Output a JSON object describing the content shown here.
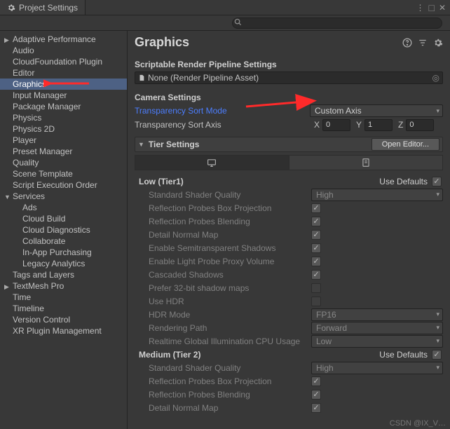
{
  "window": {
    "title": "Project Settings"
  },
  "search": {
    "placeholder": ""
  },
  "sidebar": [
    {
      "label": "Adaptive Performance",
      "has_children": true,
      "selected": false
    },
    {
      "label": "Audio"
    },
    {
      "label": "CloudFoundation Plugin"
    },
    {
      "label": "Editor"
    },
    {
      "label": "Graphics",
      "selected": true
    },
    {
      "label": "Input Manager"
    },
    {
      "label": "Package Manager"
    },
    {
      "label": "Physics"
    },
    {
      "label": "Physics 2D"
    },
    {
      "label": "Player"
    },
    {
      "label": "Preset Manager"
    },
    {
      "label": "Quality"
    },
    {
      "label": "Scene Template"
    },
    {
      "label": "Script Execution Order"
    },
    {
      "label": "Services",
      "expanded": true,
      "children": [
        {
          "label": "Ads"
        },
        {
          "label": "Cloud Build"
        },
        {
          "label": "Cloud Diagnostics"
        },
        {
          "label": "Collaborate"
        },
        {
          "label": "In-App Purchasing"
        },
        {
          "label": "Legacy Analytics"
        }
      ]
    },
    {
      "label": "Tags and Layers"
    },
    {
      "label": "TextMesh Pro",
      "has_children": true
    },
    {
      "label": "Time"
    },
    {
      "label": "Timeline"
    },
    {
      "label": "Version Control"
    },
    {
      "label": "XR Plugin Management"
    }
  ],
  "page": {
    "title": "Graphics",
    "srp": {
      "title": "Scriptable Render Pipeline Settings",
      "value": "None (Render Pipeline Asset)"
    },
    "camera": {
      "title": "Camera Settings",
      "sort_mode_label": "Transparency Sort Mode",
      "sort_mode_value": "Custom Axis",
      "sort_axis_label": "Transparency Sort Axis",
      "x_label": "X",
      "x": "0",
      "y_label": "Y",
      "y": "1",
      "z_label": "Z",
      "z": "0"
    },
    "tier": {
      "header": "Tier Settings",
      "open_editor": "Open Editor...",
      "use_defaults_label": "Use Defaults",
      "groups": [
        {
          "head": "Low (Tier1)",
          "use_defaults": true,
          "rows": [
            {
              "label": "Standard Shader Quality",
              "type": "dropdown",
              "value": "High"
            },
            {
              "label": "Reflection Probes Box Projection",
              "type": "check",
              "value": true
            },
            {
              "label": "Reflection Probes Blending",
              "type": "check",
              "value": true
            },
            {
              "label": "Detail Normal Map",
              "type": "check",
              "value": true
            },
            {
              "label": "Enable Semitransparent Shadows",
              "type": "check",
              "value": true
            },
            {
              "label": "Enable Light Probe Proxy Volume",
              "type": "check",
              "value": true
            },
            {
              "label": "Cascaded Shadows",
              "type": "check",
              "value": true
            },
            {
              "label": "Prefer 32-bit shadow maps",
              "type": "check",
              "value": false
            },
            {
              "label": "Use HDR",
              "type": "check",
              "value": false
            },
            {
              "label": "HDR Mode",
              "type": "dropdown",
              "value": "FP16"
            },
            {
              "label": "Rendering Path",
              "type": "dropdown",
              "value": "Forward"
            },
            {
              "label": "Realtime Global Illumination CPU Usage",
              "type": "dropdown",
              "value": "Low"
            }
          ]
        },
        {
          "head": "Medium (Tier 2)",
          "use_defaults": true,
          "rows": [
            {
              "label": "Standard Shader Quality",
              "type": "dropdown",
              "value": "High"
            },
            {
              "label": "Reflection Probes Box Projection",
              "type": "check",
              "value": true
            },
            {
              "label": "Reflection Probes Blending",
              "type": "check",
              "value": true
            },
            {
              "label": "Detail Normal Map",
              "type": "check",
              "value": true
            }
          ]
        }
      ]
    }
  },
  "watermark": "CSDN @IX_V…"
}
